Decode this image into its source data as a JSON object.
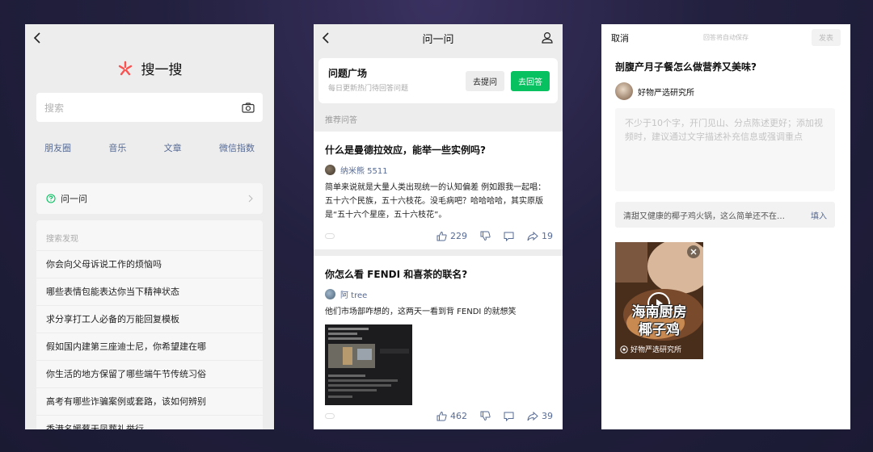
{
  "colors": {
    "link": "#576b95",
    "accent_green": "#07c160",
    "logo_red": "#fa5151"
  },
  "search_panel": {
    "title": "搜一搜",
    "search_placeholder": "搜索",
    "categories": [
      "朋友圈",
      "音乐",
      "文章",
      "微信指数"
    ],
    "ask_entry": "问一问",
    "discover_header": "搜索发现",
    "discover_items": [
      "你会向父母诉说工作的烦恼吗",
      "哪些表情包能表达你当下精神状态",
      "求分享打工人必备的万能回复模板",
      "假如国内建第三座迪士尼，你希望建在哪",
      "你生活的地方保留了哪些端午节传统习俗",
      "高考有哪些诈骗案例或套路，该如何辨别",
      "香港名媛蔡天凤葬礼举行"
    ]
  },
  "ask_panel": {
    "title": "问一问",
    "plaza_title": "问题广场",
    "plaza_subtitle": "每日更新热门待回答问题",
    "ask_button": "去提问",
    "answer_button": "去回答",
    "section_label": "推荐问答",
    "cards": [
      {
        "question": "什么是曼德拉效应，能举一些实例吗?",
        "author": "纳米熊 5511",
        "body": "简单来说就是大量人类出现统一的认知偏差 例如跟我一起唱：五十六个民族，五十六枝花。没毛病吧？哈哈哈哈，其实原版是“五十六个星座，五十六枝花”。",
        "likes": "229",
        "shares": "19"
      },
      {
        "question": "你怎么看 FENDI 和喜茶的联名?",
        "author": "阿 tree",
        "body": "他们市场部咋想的，这两天一看到背 FENDI 的就想笑",
        "likes": "462",
        "shares": "39"
      }
    ]
  },
  "answer_panel": {
    "cancel": "取消",
    "autosave": "回答将自动保存",
    "publish": "发表",
    "question": "剖腹产月子餐怎么做营养又美味?",
    "author": "好物严选研究所",
    "placeholder": "不少于10个字，开门见山、分点陈述更好；添加视频时，建议通过文字描述补充信息或强调重点",
    "suggestion": "清甜又健康的椰子鸡火锅，这么简单还不在…",
    "fill": "填入",
    "video_title_1": "海南厨房",
    "video_title_2": "椰子鸡",
    "video_source": "好物严选研究所"
  }
}
